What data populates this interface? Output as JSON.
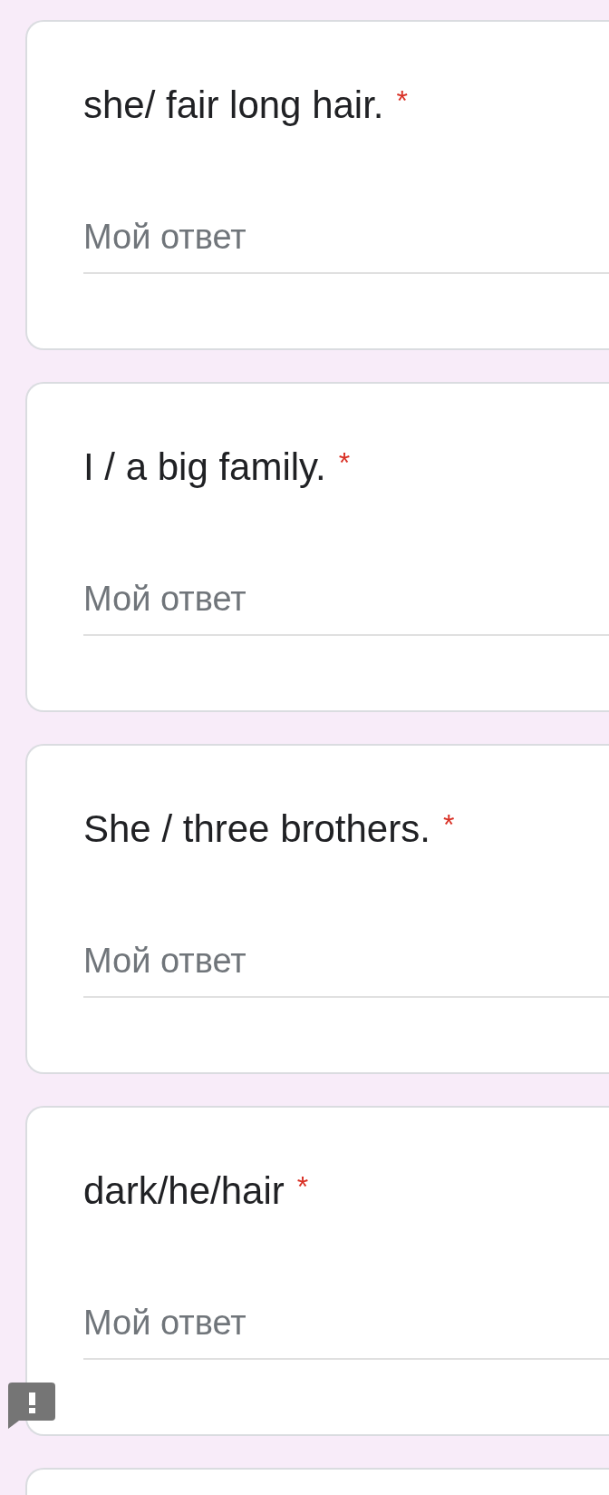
{
  "questions": [
    {
      "title": "she/ fair long hair.",
      "required_mark": "*",
      "placeholder": "Мой ответ"
    },
    {
      "title": "I / a big family.",
      "required_mark": "*",
      "placeholder": "Мой ответ"
    },
    {
      "title": "She / three brothers.",
      "required_mark": "*",
      "placeholder": "Мой ответ"
    },
    {
      "title": "dark/he/hair",
      "required_mark": "*",
      "placeholder": "Мой ответ"
    }
  ]
}
